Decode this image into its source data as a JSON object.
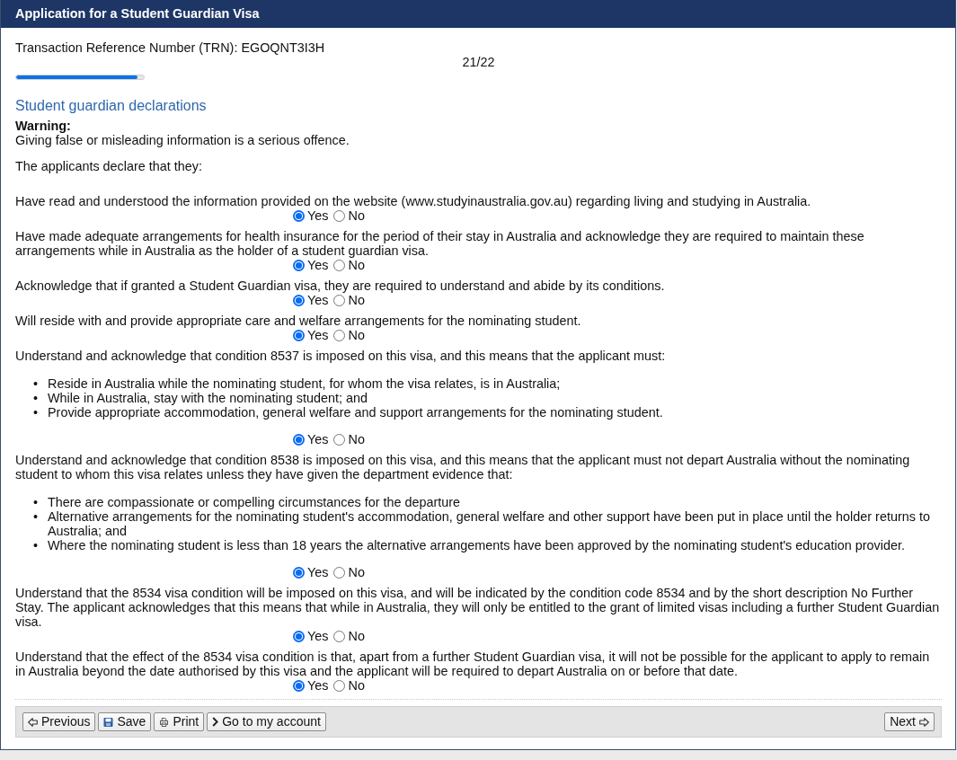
{
  "header": {
    "title": "Application for a Student Guardian Visa"
  },
  "trn": "Transaction Reference Number (TRN): EGOQNT3I3H",
  "progress": {
    "page": "21/22",
    "level": 0.95
  },
  "section": {
    "heading": "Student guardian declarations",
    "warning_title": "Warning:",
    "warning_text": "Giving false or misleading information is a serious offence.",
    "intro": "The applicants declare that they:"
  },
  "questions": [
    {
      "text": "Have read and understood the information provided on the website (www.studyinaustralia.gov.au) regarding living and studying in Australia.",
      "options": [
        {
          "label": "Yes",
          "selected": true
        },
        {
          "label": "No",
          "selected": false
        }
      ]
    },
    {
      "text": "Have made adequate arrangements for health insurance for the period of their stay in Australia and acknowledge they are required to maintain these arrangements while in Australia as the holder of a student guardian visa.",
      "options": [
        {
          "label": "Yes",
          "selected": true
        },
        {
          "label": "No",
          "selected": false
        }
      ]
    },
    {
      "text": "Acknowledge that if granted a Student Guardian visa, they are required to understand and abide by its conditions.",
      "options": [
        {
          "label": "Yes",
          "selected": true
        },
        {
          "label": "No",
          "selected": false
        }
      ]
    },
    {
      "text": "Will reside with and provide appropriate care and welfare arrangements for the nominating student.",
      "options": [
        {
          "label": "Yes",
          "selected": true
        },
        {
          "label": "No",
          "selected": false
        }
      ]
    },
    {
      "text": "Understand and acknowledge that condition 8537 is imposed on this visa, and this means that the applicant must:",
      "bullets": [
        {
          "marker": "•",
          "text": "Reside in Australia while the nominating student, for whom the visa relates, is in Australia;"
        },
        {
          "marker": "•",
          "text": "While in Australia, stay with the nominating student; and"
        },
        {
          "marker": "•",
          "text": "Provide appropriate accommodation, general welfare and support arrangements for the nominating student."
        }
      ],
      "options": [
        {
          "label": "Yes",
          "selected": true
        },
        {
          "label": "No",
          "selected": false
        }
      ]
    },
    {
      "text": "Understand and acknowledge that condition 8538 is imposed on this visa, and this means that the applicant must not depart Australia without the nominating student to whom this visa relates unless they have given the department evidence that:",
      "bullets": [
        {
          "marker": "•",
          "text": "There are compassionate or compelling circumstances for the departure"
        },
        {
          "marker": "•",
          "text": "Alternative arrangements for the nominating student's accommodation, general welfare and other support have been put in place until the holder returns to Australia; and"
        },
        {
          "marker": "•",
          "text": "Where the nominating student is less than 18 years the alternative arrangements have been approved by the nominating student's education provider."
        }
      ],
      "options": [
        {
          "label": "Yes",
          "selected": true
        },
        {
          "label": "No",
          "selected": false
        }
      ]
    },
    {
      "text": "Understand that the 8534 visa condition will be imposed on this visa, and will be indicated by the condition code 8534 and by the short description No Further Stay. The applicant acknowledges that this means that while in Australia, they will only be entitled to the grant of limited visas including a further Student Guardian visa.",
      "options": [
        {
          "label": "Yes",
          "selected": true
        },
        {
          "label": "No",
          "selected": false
        }
      ]
    },
    {
      "text": "Understand that the effect of the 8534 visa condition is that, apart from a further Student Guardian visa, it will not be possible for the applicant to apply to remain in Australia beyond the date authorised by this visa and the applicant will be required to depart Australia on or before that date.",
      "options": [
        {
          "label": "Yes",
          "selected": true
        },
        {
          "label": "No",
          "selected": false
        }
      ]
    }
  ],
  "footer": {
    "left_buttons": [
      {
        "label": "Previous"
      },
      {
        "label": "Save"
      },
      {
        "label": "Print"
      },
      {
        "label": "Go to my account"
      }
    ],
    "right_buttons": [
      {
        "label": "Next"
      }
    ]
  }
}
